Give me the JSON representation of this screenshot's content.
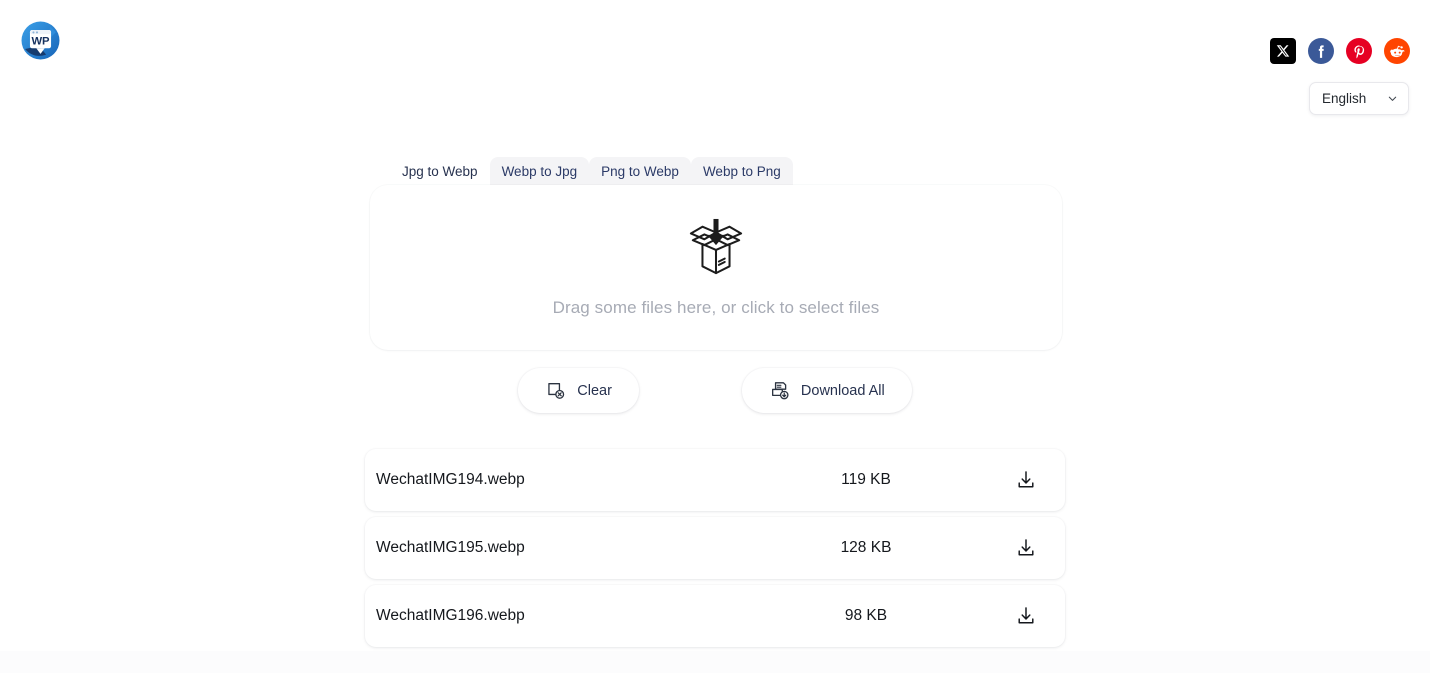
{
  "header": {
    "logo_alt": "WP",
    "logo_text": "WP",
    "social": [
      {
        "name": "x-twitter",
        "label": "X",
        "color": "#000000"
      },
      {
        "name": "facebook",
        "label": "Facebook",
        "color": "#3b5998"
      },
      {
        "name": "pinterest",
        "label": "Pinterest",
        "color": "#e60023"
      },
      {
        "name": "reddit",
        "label": "Reddit",
        "color": "#ff4500"
      }
    ],
    "language": {
      "value": "English",
      "icon": "chevron-down-icon"
    }
  },
  "tabs": [
    {
      "label": "Jpg to Webp",
      "active": true
    },
    {
      "label": "Webp to Jpg",
      "active": false
    },
    {
      "label": "Png to Webp",
      "active": false
    },
    {
      "label": "Webp to Png",
      "active": false
    }
  ],
  "dropzone": {
    "icon": "open-box-download-icon",
    "text": "Drag some files here, or click to select files"
  },
  "actions": {
    "clear_label": "Clear",
    "clear_icon": "file-remove-icon",
    "download_all_label": "Download All",
    "download_all_icon": "files-download-icon"
  },
  "files": [
    {
      "name": "WechatIMG194.webp",
      "size": "119 KB",
      "icon": "download-icon"
    },
    {
      "name": "WechatIMG195.webp",
      "size": "128 KB",
      "icon": "download-icon"
    },
    {
      "name": "WechatIMG196.webp",
      "size": "98 KB",
      "icon": "download-icon"
    }
  ],
  "colors": {
    "page_background": "#ffffff",
    "tab_inactive_background": "#f4f4f6",
    "tab_text": "#2b3a67",
    "placeholder_text": "#a7abb5",
    "logo_blue": "#1e7fd4",
    "logo_navy": "#14305e"
  }
}
